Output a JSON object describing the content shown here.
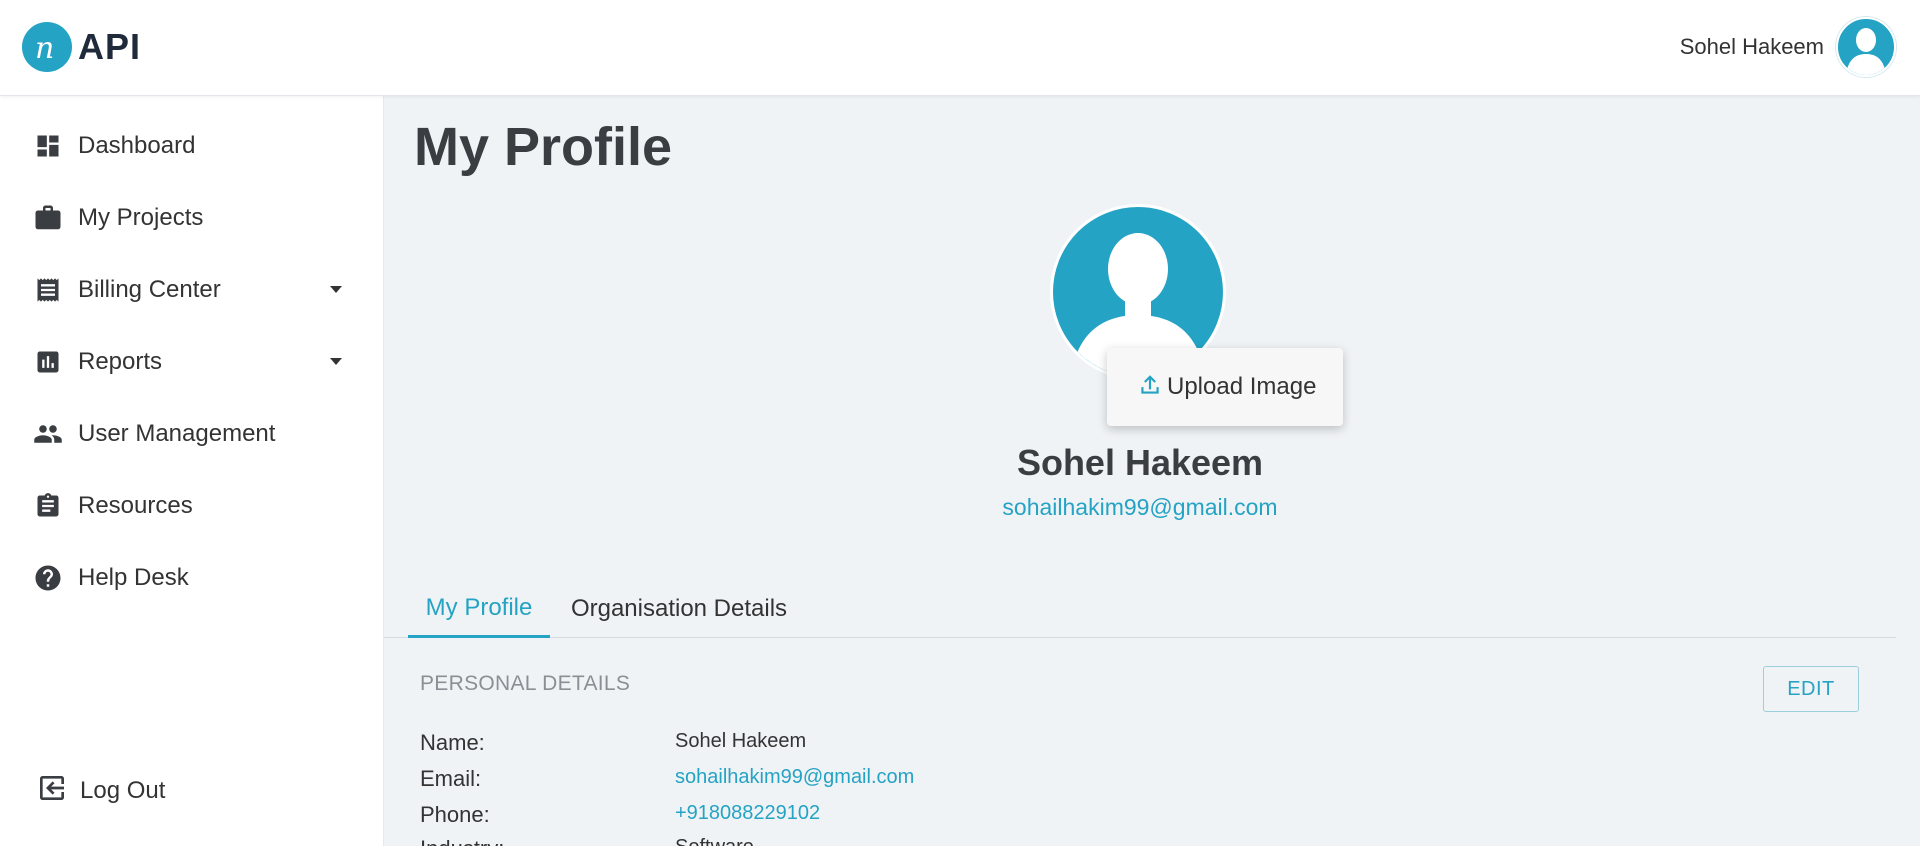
{
  "header": {
    "logo_text": "API",
    "user_name": "Sohel Hakeem"
  },
  "sidebar": {
    "items": [
      {
        "label": "Dashboard",
        "icon": "dashboard-icon"
      },
      {
        "label": "My Projects",
        "icon": "briefcase-icon"
      },
      {
        "label": "Billing Center",
        "icon": "receipt-icon",
        "has_dropdown": true
      },
      {
        "label": "Reports",
        "icon": "bar-chart-icon",
        "has_dropdown": true
      },
      {
        "label": "User Management",
        "icon": "people-icon"
      },
      {
        "label": "Resources",
        "icon": "clipboard-icon"
      },
      {
        "label": "Help Desk",
        "icon": "help-circle-icon"
      }
    ],
    "logout_label": "Log Out"
  },
  "main": {
    "title": "My Profile",
    "upload_label": "Upload Image",
    "profile_name": "Sohel Hakeem",
    "profile_email": "sohailhakim99@gmail.com",
    "tabs": [
      {
        "label": "My Profile",
        "active": true
      },
      {
        "label": "Organisation Details",
        "active": false
      }
    ],
    "section_title": "PERSONAL DETAILS",
    "edit_label": "EDIT",
    "details": [
      {
        "key": "Name:",
        "value": "Sohel Hakeem"
      },
      {
        "key": "Email:",
        "value": "sohailhakim99@gmail.com"
      },
      {
        "key": "Phone:",
        "value": "+918088229102"
      },
      {
        "key": "Industry:",
        "value": "Software"
      }
    ]
  },
  "colors": {
    "accent": "#24a3c4",
    "background": "#f0f3f6",
    "text": "#333333"
  }
}
